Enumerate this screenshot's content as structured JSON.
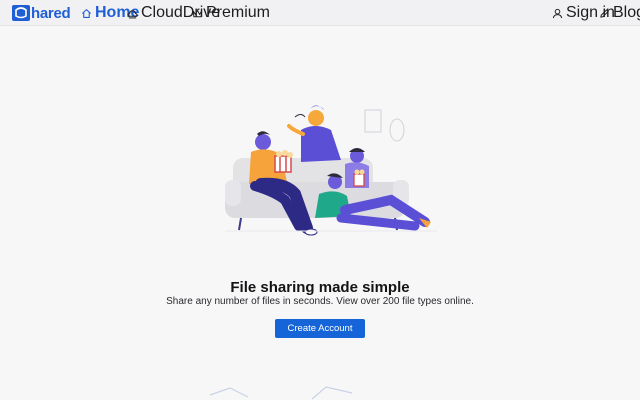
{
  "brand": {
    "logo_text": "hared",
    "logo_letter": "S",
    "accent": "#1f5fd6"
  },
  "nav": {
    "home": {
      "label": "Home",
      "icon": "home-icon"
    },
    "clouddrive": {
      "label": "CloudDrive",
      "icon": "cloud-icon"
    },
    "premium": {
      "label": "Premium",
      "icon": "crown-icon"
    },
    "signin": {
      "label": "Sign in",
      "icon": "user-icon"
    },
    "blog": {
      "label": "Blog",
      "icon": "pencil-icon"
    }
  },
  "hero": {
    "title": "File sharing made simple",
    "subtitle": "Share any number of files in seconds. View over 200 file types online.",
    "cta_label": "Create Account",
    "cta_color": "#1565d8"
  }
}
